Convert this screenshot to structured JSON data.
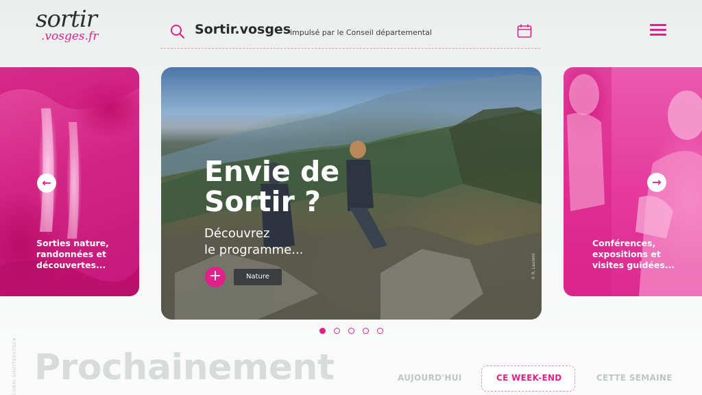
{
  "header": {
    "logo_main": "sortir",
    "logo_sub": ".vosges.fr",
    "brand": "Sortir.vosges",
    "tagline": "impulsé par le Conseil départemental",
    "icons": [
      "search-icon",
      "calendar-icon",
      "hamburger-menu-icon"
    ]
  },
  "carousel": {
    "left_card": {
      "caption": "Sorties nature, randonnées et découvertes..."
    },
    "center_card": {
      "title": "Envie de\nSortir ?",
      "subtitle": "Découvrez\nle programme...",
      "plus_label": "+",
      "category": "Nature",
      "photo_credit": "© R. Laurent"
    },
    "right_card": {
      "caption": "Conférences, expositions et visites guidées..."
    },
    "prev_arrow": "←",
    "next_arrow": "→",
    "pager": {
      "count": 5,
      "active": 0
    }
  },
  "upcoming": {
    "vertical_credit": "COBRI-SHUTTERSTOCK",
    "title": "Prochainement",
    "tabs": [
      {
        "label": "AUJOURD'HUI",
        "active": false
      },
      {
        "label": "CE WEEK-END",
        "active": true
      },
      {
        "label": "CETTE SEMAINE",
        "active": false
      }
    ]
  },
  "colors": {
    "accent": "#e0218a",
    "text_dark": "#2b2b2b",
    "muted": "#c2c4c4"
  }
}
